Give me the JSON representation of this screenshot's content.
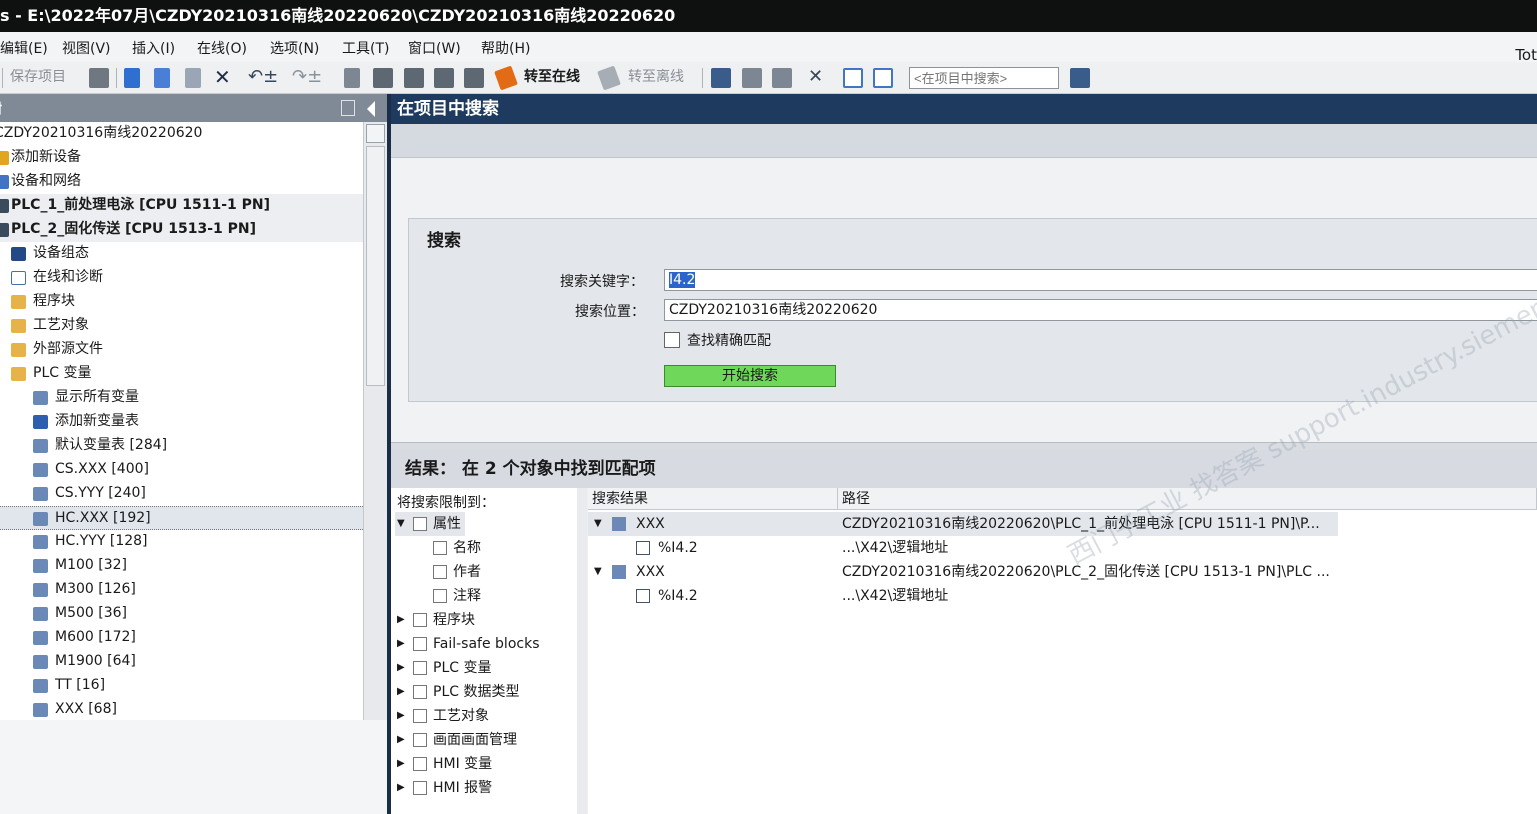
{
  "window": {
    "title": "s - E:\\2022年07月\\CZDY20210316南线20220620\\CZDY20210316南线20220620"
  },
  "menu": {
    "items": [
      "编辑(E)",
      "视图(V)",
      "插入(I)",
      "在线(O)",
      "选项(N)",
      "工具(T)",
      "窗口(W)",
      "帮助(H)"
    ],
    "right_text": "Tot"
  },
  "toolbar": {
    "save_label": "保存项目",
    "go_online_label": "转至在线",
    "go_offline_label": "转至离线",
    "search_placeholder": "<在项目中搜索>"
  },
  "project_tree": {
    "title": "树",
    "rows": [
      {
        "label": "CZDY20210316南线20220620"
      },
      {
        "label": "添加新设备"
      },
      {
        "label": "设备和网络"
      },
      {
        "label": "PLC_1_前处理电泳 [CPU 1511-1 PN]"
      },
      {
        "label": "PLC_2_固化传送 [CPU 1513-1 PN]"
      },
      {
        "label": "设备组态"
      },
      {
        "label": "在线和诊断"
      },
      {
        "label": "程序块"
      },
      {
        "label": "工艺对象"
      },
      {
        "label": "外部源文件"
      },
      {
        "label": "PLC 变量"
      },
      {
        "label": "显示所有变量"
      },
      {
        "label": "添加新变量表"
      },
      {
        "label": "默认变量表 [284]"
      },
      {
        "label": "CS.XXX [400]"
      },
      {
        "label": "CS.YYY [240]"
      },
      {
        "label": "HC.XXX [192]"
      },
      {
        "label": "HC.YYY [128]"
      },
      {
        "label": "M100 [32]"
      },
      {
        "label": "M300 [126]"
      },
      {
        "label": "M500 [36]"
      },
      {
        "label": "M600 [172]"
      },
      {
        "label": "M1900 [64]"
      },
      {
        "label": "TT [16]"
      },
      {
        "label": "XXX [68]"
      }
    ]
  },
  "search_panel": {
    "title": "在项目中搜索",
    "section_title": "搜索",
    "keyword_label": "搜索关键字：",
    "keyword_value": "I4.2",
    "location_label": "搜索位置：",
    "location_value": "CZDY20210316南线20220620",
    "exact_match_label": "查找精确匹配",
    "start_button": "开始搜索"
  },
  "results": {
    "header": "结果： 在 2 个对象中找到匹配项",
    "filter_title": "将搜索限制到：",
    "filters": [
      {
        "label": "属性"
      },
      {
        "label": "名称"
      },
      {
        "label": "作者"
      },
      {
        "label": "注释"
      },
      {
        "label": "程序块"
      },
      {
        "label": "Fail-safe blocks"
      },
      {
        "label": "PLC 变量"
      },
      {
        "label": "PLC 数据类型"
      },
      {
        "label": "工艺对象"
      },
      {
        "label": "画面画面管理"
      },
      {
        "label": "HMI 变量"
      },
      {
        "label": "HMI 报警"
      }
    ],
    "columns": [
      "搜索结果",
      "路径"
    ],
    "rows": [
      {
        "name": "XXX",
        "path": "CZDY20210316南线20220620\\PLC_1_前处理电泳 [CPU 1511-1 PN]\\P..."
      },
      {
        "name": "%I4.2",
        "path": "...\\X42\\逻辑地址"
      },
      {
        "name": "XXX",
        "path": "CZDY20210316南线20220620\\PLC_2_固化传送 [CPU 1513-1 PN]\\PLC ..."
      },
      {
        "name": "%I4.2",
        "path": "...\\X42\\逻辑地址"
      }
    ]
  },
  "watermark": "西门子工业 找答案 support.industry.siemens.com/cs"
}
